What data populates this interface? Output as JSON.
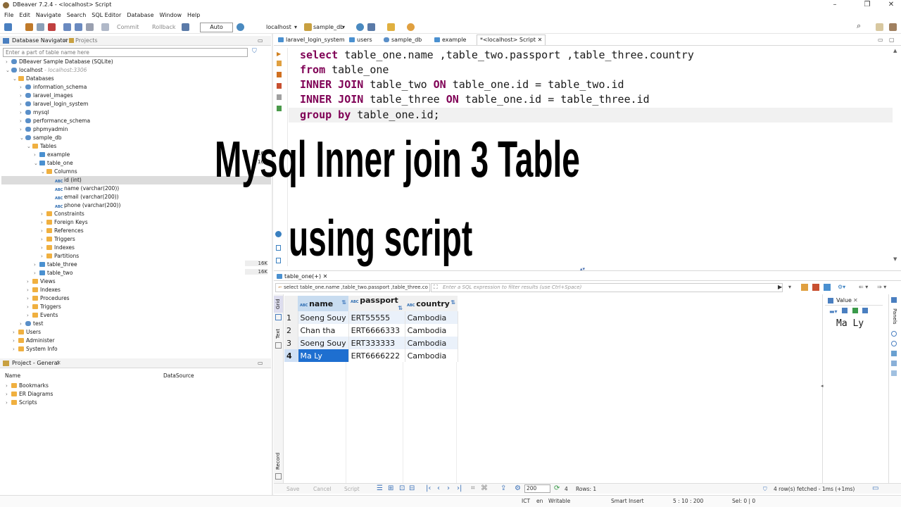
{
  "window": {
    "title": "DBeaver 7.2.4 - <localhost> Script"
  },
  "menu": [
    "File",
    "Edit",
    "Navigate",
    "Search",
    "SQL Editor",
    "Database",
    "Window",
    "Help"
  ],
  "toolbar": {
    "commit": "Commit",
    "rollback": "Rollback",
    "transaction_mode": "Auto",
    "connection": "localhost",
    "database": "sample_db"
  },
  "navigator": {
    "tab_label": "Database Navigator",
    "projects_tab": "Projects",
    "filter_placeholder": "Enter a part of table name here",
    "tree": [
      "DBeaver Sample Database (SQLite)",
      "localhost",
      "- localhost:3306",
      "Databases",
      "information_schema",
      "laravel_images",
      "laravel_login_system",
      "mysql",
      "performance_schema",
      "phpmyadmin",
      "sample_db",
      "Tables",
      "example",
      "table_one",
      "Columns",
      "id (int)",
      "name (varchar(200))",
      "email (varchar(200))",
      "phone (varchar(200))",
      "Constraints",
      "Foreign Keys",
      "References",
      "Triggers",
      "Indexes",
      "Partitions",
      "table_three",
      "table_two",
      "Views",
      "Indexes",
      "Procedures",
      "Triggers",
      "Events",
      "test",
      "Users",
      "Administer",
      "System Info"
    ],
    "size_badges": [
      "16K",
      "16K",
      "16K",
      "16K"
    ]
  },
  "project_panel": {
    "title": "Project - General",
    "col_name": "Name",
    "col_datasource": "DataSource",
    "items": [
      "Bookmarks",
      "ER Diagrams",
      "Scripts"
    ]
  },
  "editor_tabs": [
    "laravel_login_system",
    "users",
    "sample_db",
    "example",
    "*<localhost> Script"
  ],
  "sql_lines": [
    {
      "kw": "select",
      "rest": " table_one.name ,table_two.passport ,table_three.country"
    },
    {
      "kw": "from",
      "rest": " table_one"
    },
    {
      "kw": "INNER JOIN",
      "rest": " table_two ",
      "kw2": "ON",
      "rest2": " table_one.id = table_two.id"
    },
    {
      "kw": "INNER JOIN",
      "rest": " table_three ",
      "kw2": "ON",
      "rest2": " table_one.id = table_three.id"
    },
    {
      "kw": "group by",
      "rest": " table_one.id;"
    }
  ],
  "overlay": {
    "line1": "Mysql Inner join 3 Table",
    "line2": "using script"
  },
  "results": {
    "tab_label": "table_one(+)",
    "query_preview": "select table_one.name ,table_two.passport ,table_three.co",
    "filter_placeholder": "Enter a SQL expression to filter results (use Ctrl+Space)",
    "side_tabs": [
      "Grid",
      "Text",
      "Record"
    ],
    "columns": [
      "name",
      "passport",
      "country"
    ],
    "rows": [
      [
        "1",
        "Soeng Souy",
        "ERT55555",
        "Cambodia"
      ],
      [
        "2",
        "Chan tha",
        "ERT6666333",
        "Cambodia"
      ],
      [
        "3",
        "Soeng Souy",
        "ERT333333",
        "Cambodia"
      ],
      [
        "4",
        "Ma Ly",
        "ERT6666222",
        "Cambodia"
      ]
    ],
    "value_panel_title": "Value",
    "value_panel_text": "Ma Ly",
    "panels_tab": "Panels"
  },
  "results_toolbar": {
    "save": "Save",
    "cancel": "Cancel",
    "script": "Script",
    "fetch_size": "200",
    "count": "4",
    "rows_info": "Rows: 1",
    "fetched_info": "4 row(s) fetched - 1ms (+1ms)"
  },
  "statusbar": [
    "ICT",
    "en",
    "Writable",
    "Smart Insert",
    "5 : 10 : 200",
    "Sel: 0 | 0"
  ]
}
